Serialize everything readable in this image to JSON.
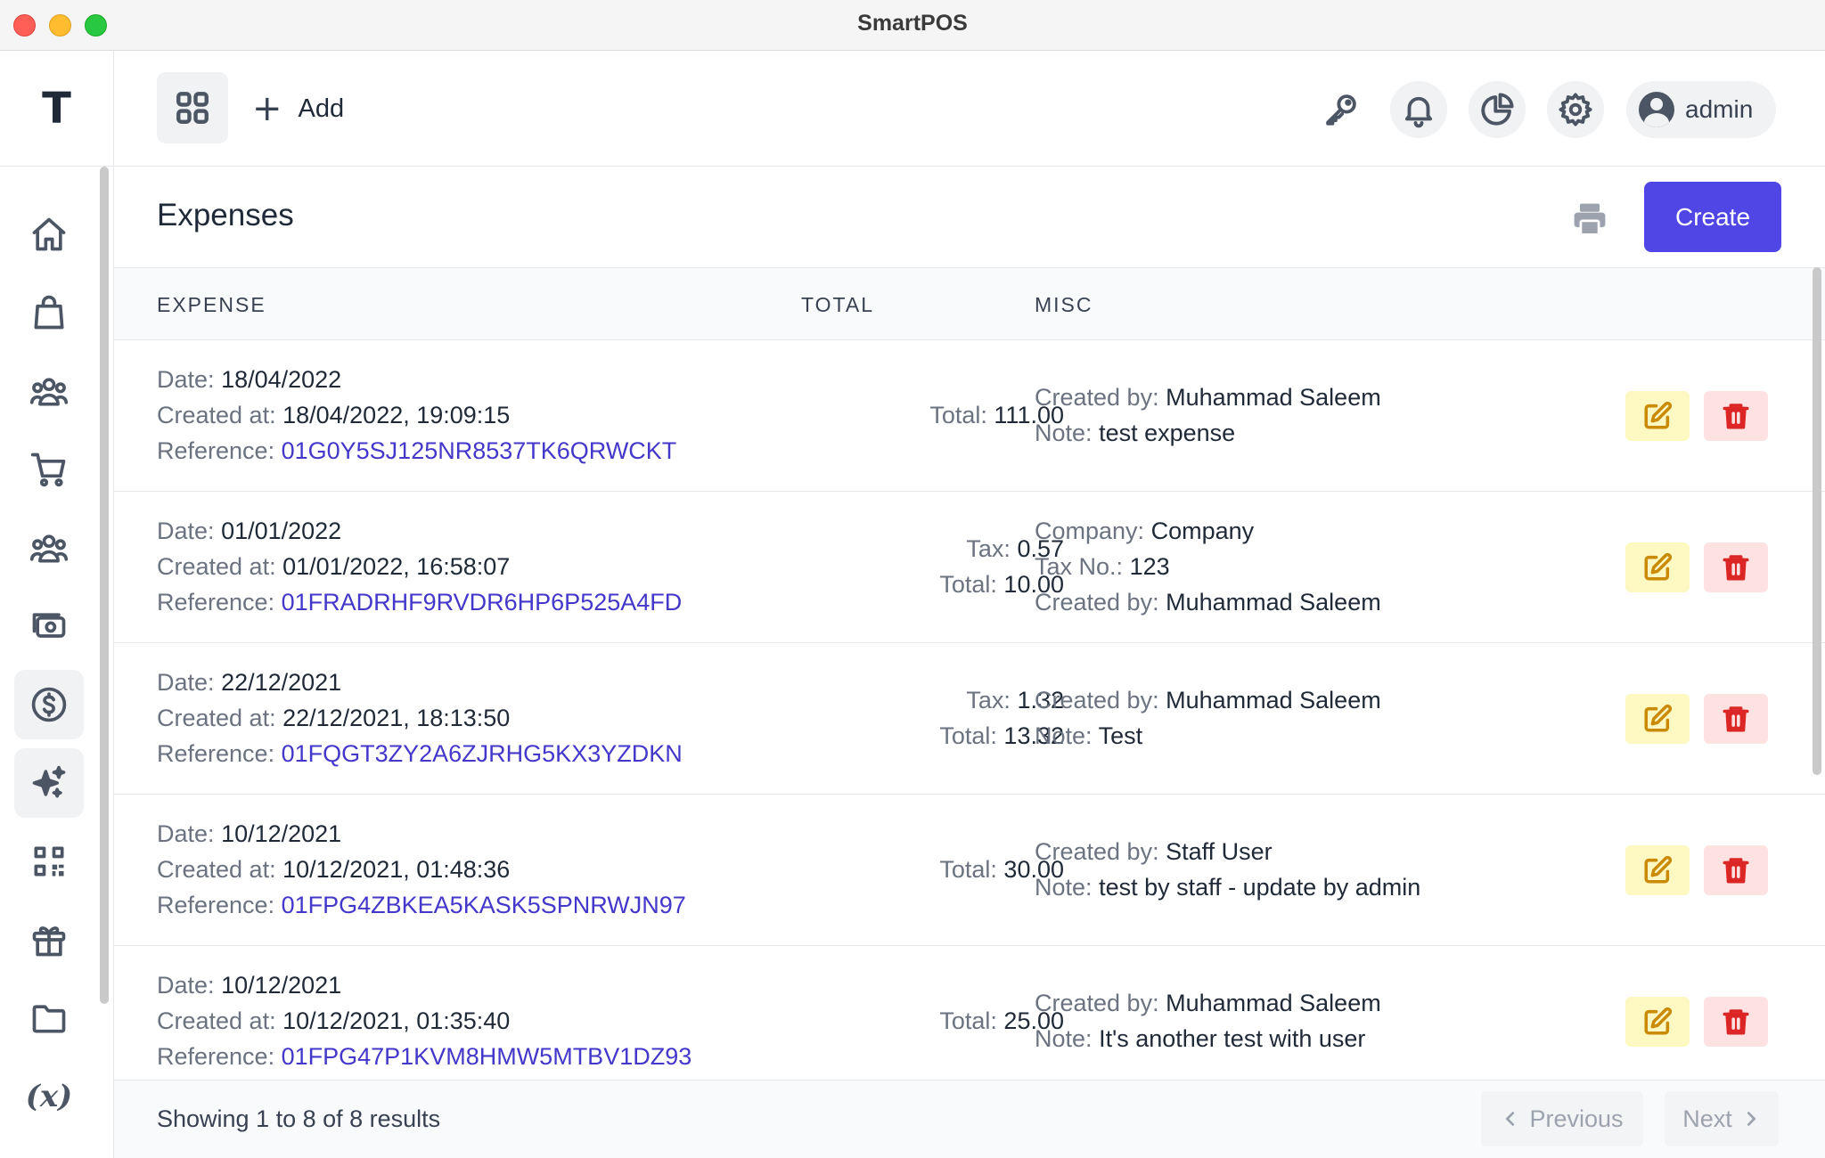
{
  "window": {
    "title": "SmartPOS"
  },
  "brand": {
    "letter": "T"
  },
  "sidebar": {
    "items": [
      {
        "icon": "home-icon",
        "active": false
      },
      {
        "icon": "shopping-bag-icon",
        "active": false
      },
      {
        "icon": "users-icon",
        "active": false
      },
      {
        "icon": "cart-icon",
        "active": false
      },
      {
        "icon": "team-icon",
        "active": false
      },
      {
        "icon": "cash-icon",
        "active": false
      },
      {
        "icon": "dollar-icon",
        "active": true
      },
      {
        "icon": "sparkles-icon",
        "active": true
      },
      {
        "icon": "qr-code-icon",
        "active": false
      },
      {
        "icon": "gift-icon",
        "active": false
      },
      {
        "icon": "folder-icon",
        "active": false
      },
      {
        "icon": "variable-icon",
        "label": "(x)",
        "active": false
      }
    ]
  },
  "topbar": {
    "add_label": "Add",
    "user_label": "admin"
  },
  "page": {
    "title": "Expenses",
    "create_label": "Create"
  },
  "table": {
    "headers": {
      "expense": "EXPENSE",
      "total": "TOTAL",
      "misc": "MISC"
    },
    "labels": {
      "date": "Date:",
      "created_at": "Created at:",
      "reference": "Reference:",
      "tax": "Tax:",
      "total": "Total:",
      "created_by": "Created by:",
      "note": "Note:",
      "company": "Company:",
      "tax_no": "Tax No.:"
    },
    "rows": [
      {
        "date": "18/04/2022",
        "created_at": "18/04/2022, 19:09:15",
        "reference": "01G0Y5SJ125NR8537TK6QRWCKT",
        "total": "111.00",
        "created_by": "Muhammad Saleem",
        "note": "test expense"
      },
      {
        "date": "01/01/2022",
        "created_at": "01/01/2022, 16:58:07",
        "reference": "01FRADRHF9RVDR6HP6P525A4FD",
        "tax": "0.57",
        "total": "10.00",
        "company": "Company",
        "tax_no": "123",
        "created_by": "Muhammad Saleem"
      },
      {
        "date": "22/12/2021",
        "created_at": "22/12/2021, 18:13:50",
        "reference": "01FQGT3ZY2A6ZJRHG5KX3YZDKN",
        "tax": "1.32",
        "total": "13.32",
        "created_by": "Muhammad Saleem",
        "note": "Test"
      },
      {
        "date": "10/12/2021",
        "created_at": "10/12/2021, 01:48:36",
        "reference": "01FPG4ZBKEA5KASK5SPNRWJN97",
        "total": "30.00",
        "created_by": "Staff User",
        "note": "test by staff - update by admin"
      },
      {
        "date": "10/12/2021",
        "created_at": "10/12/2021, 01:35:40",
        "reference": "01FPG47P1KVM8HMW5MTBV1DZ93",
        "total": "25.00",
        "created_by": "Muhammad Saleem",
        "note": "It's another test with user"
      }
    ]
  },
  "footer": {
    "showing": "Showing 1 to 8 of 8 results",
    "previous_label": "Previous",
    "next_label": "Next"
  },
  "colors": {
    "accent": "#4f46e5",
    "reference_link": "#4338ca",
    "edit_bg": "#fef9c3",
    "edit_icon": "#ca8a04",
    "delete_bg": "#fee2e2",
    "delete_icon": "#dc2626"
  }
}
